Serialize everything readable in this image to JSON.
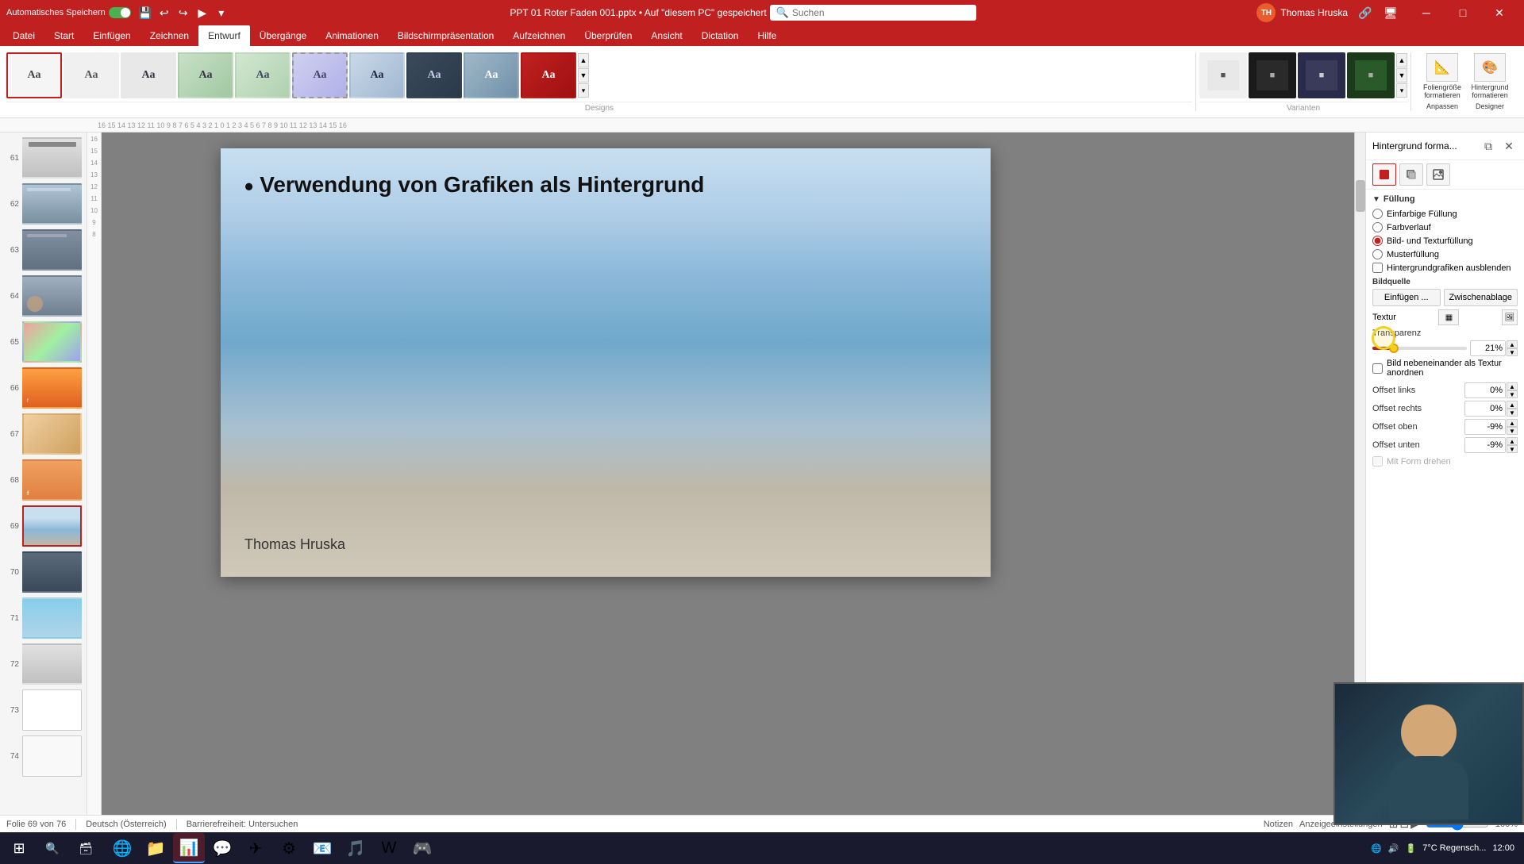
{
  "titlebar": {
    "autosave_label": "Automatisches Speichern",
    "title": "PPT 01 Roter Faden 001.pptx • Auf \"diesem PC\" gespeichert",
    "search_placeholder": "Suchen",
    "user_name": "Thomas Hruska",
    "user_initials": "TH",
    "min_btn": "─",
    "max_btn": "□",
    "close_btn": "✕"
  },
  "ribbon": {
    "tabs": [
      "Datei",
      "Start",
      "Einfügen",
      "Zeichnen",
      "Entwurf",
      "Übergänge",
      "Animationen",
      "Bildschirmpräsentation",
      "Aufzeichnen",
      "Überprüfen",
      "Ansicht",
      "Dictation",
      "Hilfe"
    ],
    "active_tab": "Entwurf",
    "section_designs": "Designs",
    "section_variants": "Varianten",
    "right_buttons": [
      "Foliengrößeformatieren",
      "Hintergrundformatieren",
      "Anpassen",
      "Designer"
    ]
  },
  "sidebar": {
    "slides": [
      {
        "num": 61,
        "type": "gray"
      },
      {
        "num": 62,
        "type": "mountain"
      },
      {
        "num": 63,
        "type": "mountain"
      },
      {
        "num": 64,
        "type": "mountain"
      },
      {
        "num": 65,
        "type": "abstract"
      },
      {
        "num": 66,
        "type": "sunset"
      },
      {
        "num": 67,
        "type": "abstract"
      },
      {
        "num": 68,
        "type": "sunset2"
      },
      {
        "num": 69,
        "type": "coast",
        "active": true
      },
      {
        "num": 70,
        "type": "dark"
      },
      {
        "num": 71,
        "type": "blue"
      },
      {
        "num": 72,
        "type": "gray"
      },
      {
        "num": 73,
        "type": "white"
      },
      {
        "num": 74,
        "type": "placeholder"
      }
    ]
  },
  "slide": {
    "text": "Verwendung von Grafiken als Hintergrund",
    "author": "Thomas Hruska"
  },
  "format_panel": {
    "title": "Hintergrund forma...",
    "sections": {
      "filling": {
        "label": "Füllung",
        "options": [
          {
            "id": "einfarbig",
            "label": "Einfarbige Füllung"
          },
          {
            "id": "farbverlauf",
            "label": "Farbverlauf"
          },
          {
            "id": "bild",
            "label": "Bild- und Texturfüllung",
            "checked": true
          },
          {
            "id": "muster",
            "label": "Musterfüllung"
          },
          {
            "id": "hide",
            "label": "Hintergrundgrafiken ausblenden",
            "type": "checkbox"
          }
        ],
        "image_source_label": "Bildquelle",
        "insert_btn": "Einfügen ...",
        "clipboard_btn": "Zwischenablage",
        "texture_label": "Textur",
        "transparency_label": "Transparenz",
        "transparency_value": "21%",
        "tile_label": "Bild nebeneinander als Textur anordnen",
        "offset_left_label": "Offset links",
        "offset_left_value": "0%",
        "offset_right_label": "Offset rechts",
        "offset_right_value": "0%",
        "offset_top_label": "Offset oben",
        "offset_top_value": "-9%",
        "offset_bottom_label": "Offset unten",
        "offset_bottom_value": "-9%",
        "mit_form_label": "Mit Form drehen"
      }
    }
  },
  "statusbar": {
    "slide_info": "Folie 69 von 76",
    "language": "Deutsch (Österreich)",
    "accessibility": "Barrierefreiheit: Untersuchen",
    "notes_btn": "Notizen",
    "display_btn": "Anzeigeeinstellungen"
  },
  "taskbar": {
    "apps": [
      "⊞",
      "🔍",
      "📋",
      "🌐",
      "📁",
      "💻",
      "📧",
      "📅",
      "🎵",
      "🖼"
    ],
    "temp": "7°C",
    "weather": "Regensch..."
  }
}
